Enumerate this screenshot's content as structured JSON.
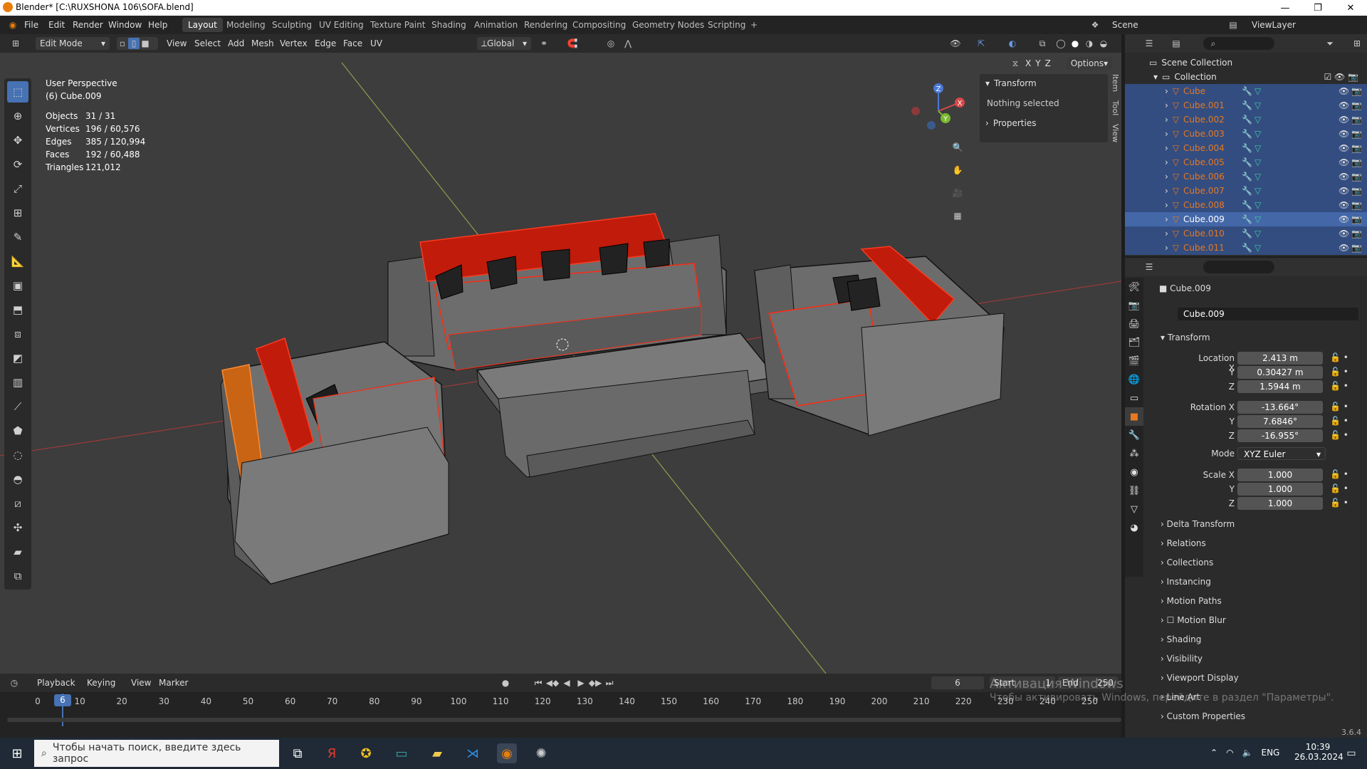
{
  "window": {
    "title": "Blender* [C:\\RUXSHONA 106\\SOFA.blend]",
    "min": "—",
    "max": "❐",
    "close": "✕"
  },
  "menu": [
    "File",
    "Edit",
    "Render",
    "Window",
    "Help"
  ],
  "workspaces": [
    "Layout",
    "Modeling",
    "Sculpting",
    "UV Editing",
    "Texture Paint",
    "Shading",
    "Animation",
    "Rendering",
    "Compositing",
    "Geometry Nodes",
    "Scripting",
    "+"
  ],
  "scene": {
    "label": "Scene",
    "viewlayer": "ViewLayer"
  },
  "viewport_header": {
    "mode": "Edit Mode",
    "menus": [
      "View",
      "Select",
      "Add",
      "Mesh",
      "Vertex",
      "Edge",
      "Face",
      "UV"
    ],
    "orientation": "Global",
    "options": "Options",
    "axes": [
      "X",
      "Y",
      "Z"
    ]
  },
  "overlay_text": {
    "perspective": "User Perspective",
    "object": "(6) Cube.009"
  },
  "stats": [
    {
      "label": "Objects",
      "value": "31 / 31"
    },
    {
      "label": "Vertices",
      "value": "196 / 60,576"
    },
    {
      "label": "Edges",
      "value": "385 / 120,994"
    },
    {
      "label": "Faces",
      "value": "192 / 60,488"
    },
    {
      "label": "Triangles",
      "value": "121,012"
    }
  ],
  "npanel": {
    "transform": "Transform",
    "nothing": "Nothing selected",
    "properties": "Properties",
    "tabs": [
      "Item",
      "Tool",
      "View"
    ]
  },
  "gizmo": {
    "x": "X",
    "y": "Y",
    "z": "Z"
  },
  "outliner": {
    "scene_collection": "Scene Collection",
    "collection": "Collection",
    "items": [
      "Cube",
      "Cube.001",
      "Cube.002",
      "Cube.003",
      "Cube.004",
      "Cube.005",
      "Cube.006",
      "Cube.007",
      "Cube.008",
      "Cube.009",
      "Cube.010",
      "Cube.011"
    ],
    "active_index": 9
  },
  "properties": {
    "object_name": "Cube.009",
    "data_name": "Cube.009",
    "transform": "Transform",
    "location": {
      "label": "Location X",
      "x": "2.413 m",
      "y": "0.30427 m",
      "z": "1.5944 m"
    },
    "rotation": {
      "label": "Rotation X",
      "x": "-13.664°",
      "y": "7.6846°",
      "z": "-16.955°"
    },
    "mode_label": "Mode",
    "mode": "XYZ Euler",
    "scale": {
      "label": "Scale X",
      "x": "1.000",
      "y": "1.000",
      "z": "1.000"
    },
    "axis_y": "Y",
    "axis_z": "Z",
    "sections": [
      "Delta Transform",
      "Relations",
      "Collections",
      "Instancing",
      "Motion Paths",
      "Motion Blur",
      "Shading",
      "Visibility",
      "Viewport Display",
      "Line Art",
      "Custom Properties"
    ]
  },
  "timeline": {
    "menus": [
      "Playback",
      "Keying",
      "View",
      "Marker"
    ],
    "current_frame": "6",
    "start_label": "Start",
    "start": "1",
    "end_label": "End",
    "end": "250",
    "ticks": [
      "0",
      "10",
      "20",
      "30",
      "40",
      "50",
      "60",
      "70",
      "80",
      "90",
      "100",
      "110",
      "120",
      "130",
      "140",
      "150",
      "160",
      "170",
      "180",
      "190",
      "200",
      "210",
      "220",
      "230",
      "240",
      "250"
    ]
  },
  "watermark": {
    "line1": "Активация Windows",
    "line2": "Чтобы активировать Windows, перейдите в раздел \"Параметры\"."
  },
  "version": "3.6.4",
  "taskbar": {
    "search_placeholder": "Чтобы начать поиск, введите здесь запрос",
    "lang": "ENG",
    "time": "10:39",
    "date": "26.03.2024"
  },
  "colors": {
    "accent": "#4772b3",
    "selected_orange": "#e8781f",
    "wire_red": "#ff2a10",
    "bg_viewport": "#3d3d3d"
  }
}
